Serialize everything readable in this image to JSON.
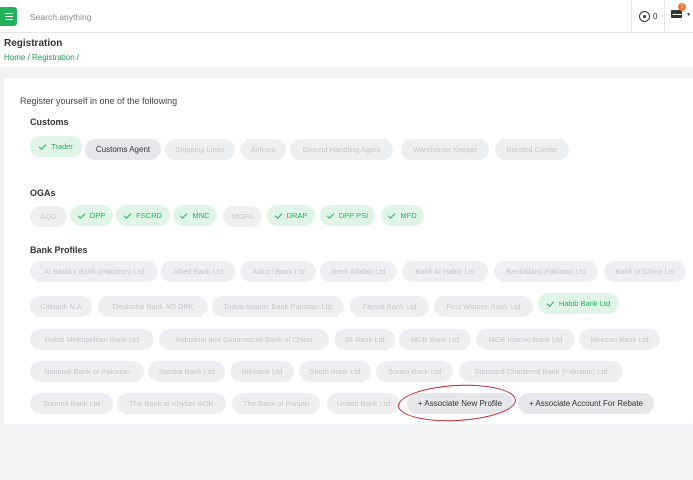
{
  "topbar": {
    "search_placeholder": "Search anything",
    "notification_count": "0",
    "mail_badge": "1"
  },
  "header": {
    "title": "Registration",
    "breadcrumb": [
      "Home",
      "Registration"
    ],
    "separator": " / "
  },
  "card": {
    "prompt": "Register yourself in one of the following",
    "sections": {
      "customs": {
        "title": "Customs",
        "chips": [
          {
            "label": "Trader",
            "state": "selected"
          },
          {
            "label": "Customs Agent",
            "state": "active"
          },
          {
            "label": "Shipping Lines",
            "state": "disabled"
          },
          {
            "label": "Airlines",
            "state": "disabled"
          },
          {
            "label": "Ground Handling Agent",
            "state": "disabled"
          },
          {
            "label": "Warehouse Keeper",
            "state": "disabled"
          },
          {
            "label": "Bonded Carrier",
            "state": "disabled"
          }
        ]
      },
      "ogas": {
        "title": "OGAs",
        "chips": [
          {
            "label": "AQD",
            "state": "disabled"
          },
          {
            "label": "DPP",
            "state": "selected"
          },
          {
            "label": "FSCRD",
            "state": "selected"
          },
          {
            "label": "MNC",
            "state": "selected"
          },
          {
            "label": "MOFA",
            "state": "disabled"
          },
          {
            "label": "DRAP",
            "state": "selected"
          },
          {
            "label": "DPP PSI",
            "state": "selected"
          },
          {
            "label": "MFD",
            "state": "selected"
          }
        ]
      },
      "banks": {
        "title": "Bank Profiles",
        "chips": [
          {
            "label": "Al Baraka Bank (Pakistan) Ltd",
            "state": "disabled"
          },
          {
            "label": "Allied Bank Ltd",
            "state": "disabled"
          },
          {
            "label": "Askari Bank Ltd",
            "state": "disabled"
          },
          {
            "label": "Bank Alfalah Ltd",
            "state": "disabled"
          },
          {
            "label": "Bank Al Habib Ltd",
            "state": "disabled"
          },
          {
            "label": "BankIslami Pakistan Ltd",
            "state": "disabled"
          },
          {
            "label": "Bank of China Ltd",
            "state": "disabled"
          },
          {
            "label": "Citibank N.A",
            "state": "disabled"
          },
          {
            "label": "Deutsche Bank AG DBK",
            "state": "disabled"
          },
          {
            "label": "Dubai Islamic Bank Pakistan Ltd",
            "state": "disabled"
          },
          {
            "label": "Faysal Bank Ltd",
            "state": "disabled"
          },
          {
            "label": "First Women Bank Ltd",
            "state": "disabled"
          },
          {
            "label": "Habib Bank Ltd",
            "state": "selected"
          },
          {
            "label": "Habib Metropolitan Bank Ltd",
            "state": "disabled"
          },
          {
            "label": "Industrial and Commercial Bank of China",
            "state": "disabled"
          },
          {
            "label": "JS Bank Ltd",
            "state": "disabled"
          },
          {
            "label": "MCB Bank Ltd",
            "state": "disabled"
          },
          {
            "label": "MCB Islamic Bank Ltd",
            "state": "disabled"
          },
          {
            "label": "Meezan Bank Ltd",
            "state": "disabled"
          },
          {
            "label": "National Bank of Pakistan",
            "state": "disabled"
          },
          {
            "label": "Samba Bank Ltd",
            "state": "disabled"
          },
          {
            "label": "Silkbank Ltd",
            "state": "disabled"
          },
          {
            "label": "Sindh Bank Ltd",
            "state": "disabled"
          },
          {
            "label": "Soneri Bank Ltd",
            "state": "disabled"
          },
          {
            "label": "Standard Chartered Bank (Pakistan) Ltd",
            "state": "disabled"
          },
          {
            "label": "Summit Bank Ltd",
            "state": "disabled"
          },
          {
            "label": "The Bank of Khyber BOK",
            "state": "disabled"
          },
          {
            "label": "The Bank of Punjab",
            "state": "disabled"
          },
          {
            "label": "United Bank Ltd",
            "state": "disabled"
          },
          {
            "label": "+ Associate New Profile",
            "state": "active"
          },
          {
            "label": "+ Associate Account For Rebate",
            "state": "active"
          }
        ]
      }
    }
  },
  "colors": {
    "brand_green": "#22b35a",
    "selected_bg": "#e0f5e7",
    "disabled_bg": "#eeeff1",
    "disabled_text": "#c6c8cc",
    "annotation_red": "#c0242b"
  },
  "icons": {
    "menu": "hamburger-icon",
    "notifications": "coin-icon",
    "mail": "envelope-icon",
    "check": "check-icon"
  }
}
